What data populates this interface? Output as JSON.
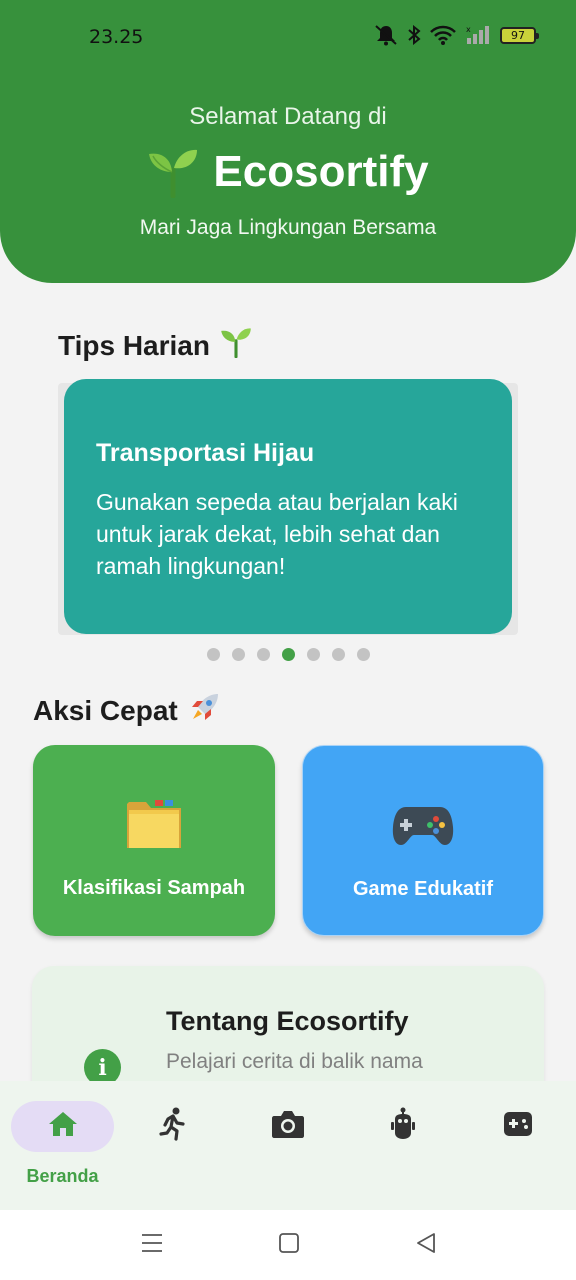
{
  "status_bar": {
    "time": "23.25",
    "battery": "97"
  },
  "header": {
    "welcome": "Selamat Datang di",
    "title_emoji": "🌱",
    "title": "Ecosortify",
    "subtitle": "Mari Jaga Lingkungan Bersama",
    "background_color": "#37913c"
  },
  "tips": {
    "section_title": "Tips Harian",
    "section_emoji": "🌱",
    "card_title": "Transportasi Hijau",
    "card_body": "Gunakan sepeda atau berjalan kaki untuk jarak dekat, lebih sehat dan ramah lingkungan!",
    "card_color": "#26a69a",
    "page_count": 7,
    "active_page": 4
  },
  "quick_actions": {
    "section_title": "Aksi Cepat",
    "section_emoji": "🚀",
    "items": [
      {
        "label": "Klasifikasi Sampah",
        "icon": "folder-icon",
        "color": "#4caf50"
      },
      {
        "label": "Game Edukatif",
        "icon": "gamepad-icon",
        "color": "#42a5f5"
      }
    ]
  },
  "about": {
    "title": "Tentang Ecosortify",
    "subtitle": "Pelajari cerita di balik nama",
    "icon": "info-icon"
  },
  "bottom_nav": {
    "items": [
      {
        "label": "Beranda",
        "icon": "home-icon",
        "active": true
      },
      {
        "label": "",
        "icon": "running-icon",
        "active": false
      },
      {
        "label": "",
        "icon": "camera-icon",
        "active": false
      },
      {
        "label": "",
        "icon": "robot-icon",
        "active": false
      },
      {
        "label": "",
        "icon": "game-controller-icon",
        "active": false
      }
    ],
    "active_color": "#43a047"
  }
}
